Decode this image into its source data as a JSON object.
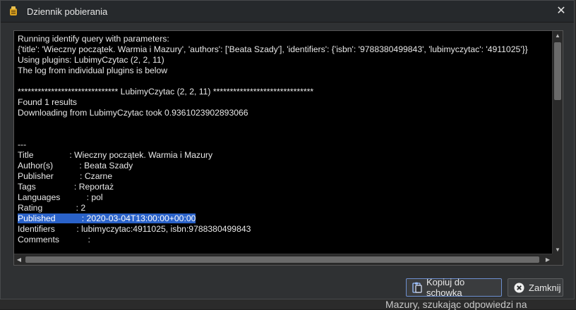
{
  "window": {
    "title": "Dziennik pobierania",
    "close_glyph": "✕"
  },
  "log": {
    "before_highlight": "Running identify query with parameters:\n{'title': 'Wieczny początek. Warmia i Mazury', 'authors': ['Beata Szady'], 'identifiers': {'isbn': '9788380499843', 'lubimyczytac': '4911025'}}\nUsing plugins: LubimyCzytac (2, 2, 11)\nThe log from individual plugins is below\n\n****************************** LubimyCzytac (2, 2, 11) ******************************\nFound 1 results\nDownloading from LubimyCzytac took 0.9361023902893066\n\n\n---\nTitle               : Wieczny początek. Warmia i Mazury\nAuthor(s)           : Beata Szady\nPublisher           : Czarne\nTags                : Reportaż\nLanguages           : pol\nRating              : 2\n",
    "highlight": "Published           : 2020-03-04T13:00:00+00:00",
    "after_highlight": "\nIdentifiers         : lubimyczytac:4911025, isbn:9788380499843\nComments            :\n\nWarmia i Mazury to od lat raj wczasowiczów, kuszący bezkresnymi jeziorami, lokalną kulturą i obietnicą relaksu. Cud natury, który"
  },
  "buttons": {
    "copy_label": "Kopiuj do schowka",
    "close_label": "Zamknij"
  },
  "background": {
    "behind_text": "Mazury, szukając odpowiedzi na"
  },
  "colors": {
    "selection": "#2a62c9",
    "log_background": "#000000"
  },
  "icons": {
    "app": "calibre-app-icon",
    "copy": "clipboard-icon",
    "close": "close-circle-icon"
  }
}
